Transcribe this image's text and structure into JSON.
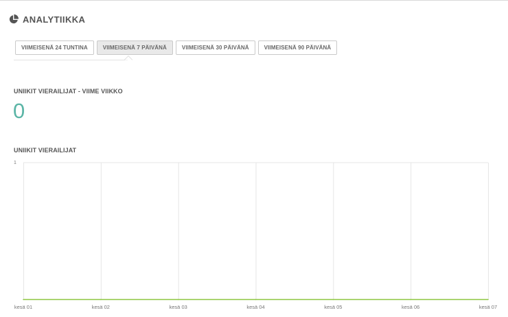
{
  "header": {
    "title": "ANALYTIIKKA",
    "icon": "pie-chart-icon"
  },
  "tabs": [
    {
      "label": "VIIMEISENÄ 24 TUNTINA",
      "active": false
    },
    {
      "label": "VIIMEISENÄ 7 PÄIVÄNÄ",
      "active": true
    },
    {
      "label": "VIIMEISENÄ 30 PÄIVÄNÄ",
      "active": false
    },
    {
      "label": "VIIMEISENÄ 90 PÄIVÄNÄ",
      "active": false
    }
  ],
  "stat": {
    "label": "UNIIKIT VIERAILIJAT - VIIME VIIKKO",
    "value": "0"
  },
  "chart_section": {
    "label": "UNIIKIT VIERAILIJAT"
  },
  "colors": {
    "accent": "#5bb5a6",
    "line": "#8cc63f",
    "grid": "#e6e6e6"
  },
  "chart_data": {
    "type": "line",
    "categories": [
      "kesä 01",
      "kesä 02",
      "kesä 03",
      "kesä 04",
      "kesä 05",
      "kesä 06",
      "kesä 07"
    ],
    "series": [
      {
        "values": [
          0,
          0,
          0,
          0,
          0,
          0,
          0
        ]
      }
    ],
    "ylim": [
      0,
      1
    ],
    "yticks": [
      "1"
    ],
    "grid": true
  }
}
